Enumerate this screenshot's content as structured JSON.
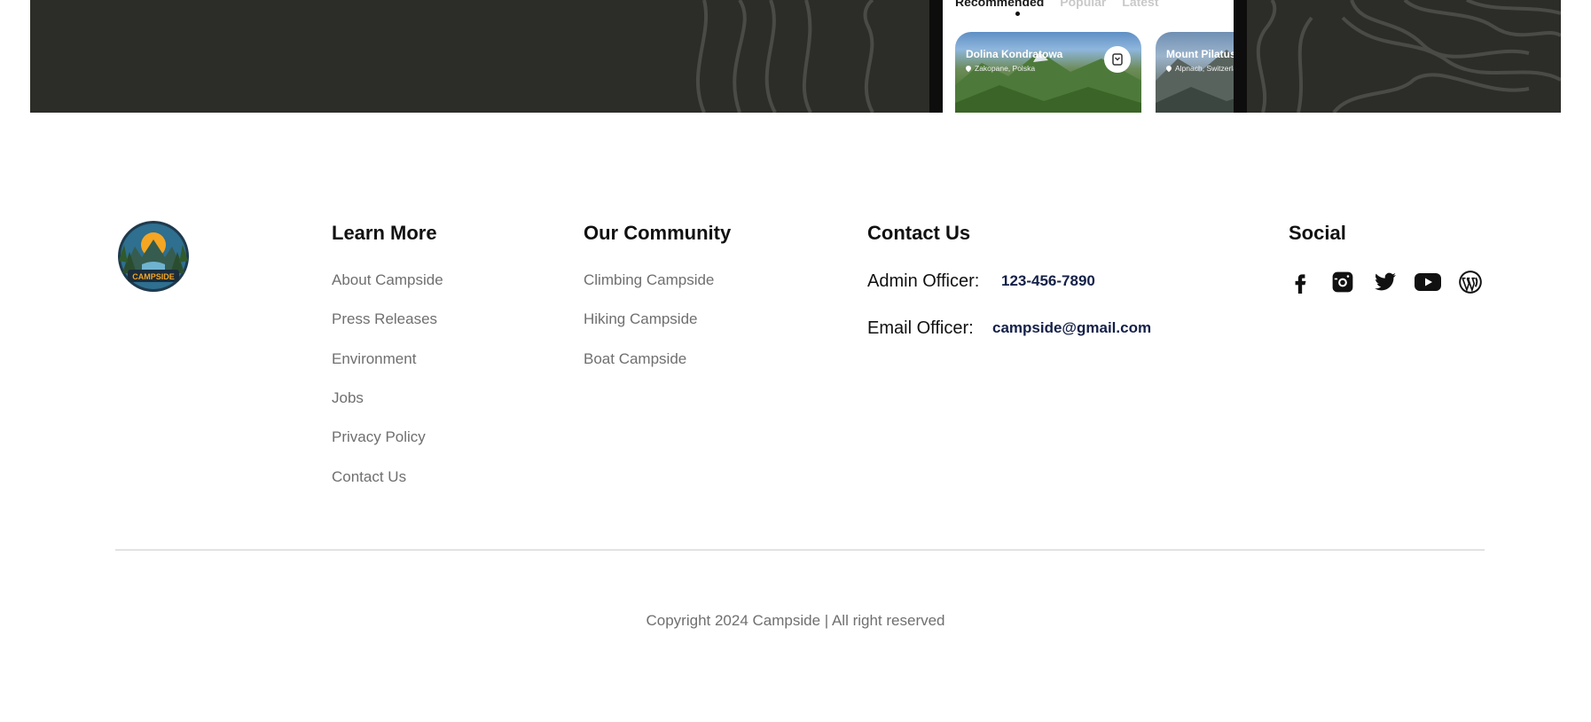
{
  "banner": {
    "app_tabs": [
      "Recommended",
      "Popular",
      "Latest"
    ],
    "cards": [
      {
        "title": "Dolina Kondratowa",
        "location": "Zakopane, Polska"
      },
      {
        "title": "Mount Pilatus",
        "location": "Alpnach, Switzerland"
      }
    ]
  },
  "logo": {
    "text": "CAMPSIDE"
  },
  "learn_more": {
    "title": "Learn More",
    "links": [
      "About Campside",
      "Press Releases",
      "Environment",
      "Jobs",
      "Privacy Policy",
      "Contact Us"
    ]
  },
  "community": {
    "title": "Our Community",
    "links": [
      "Climbing Campside",
      "Hiking Campside",
      "Boat Campside"
    ]
  },
  "contact": {
    "title": "Contact Us",
    "admin_label": "Admin Officer:",
    "admin_value": "123-456-7890",
    "email_label": "Email Officer:",
    "email_value": "campside@gmail.com"
  },
  "social": {
    "title": "Social",
    "icons": [
      "facebook-icon",
      "instagram-icon",
      "twitter-icon",
      "youtube-icon",
      "wordpress-icon"
    ]
  },
  "footer": {
    "copyright": "Copyright 2024 Campside | All right reserved"
  },
  "colors": {
    "banner_bg": "#2c2d29",
    "link_gray": "#6f6f6f",
    "contact_value": "#142048",
    "logo_orange": "#f5a623"
  }
}
